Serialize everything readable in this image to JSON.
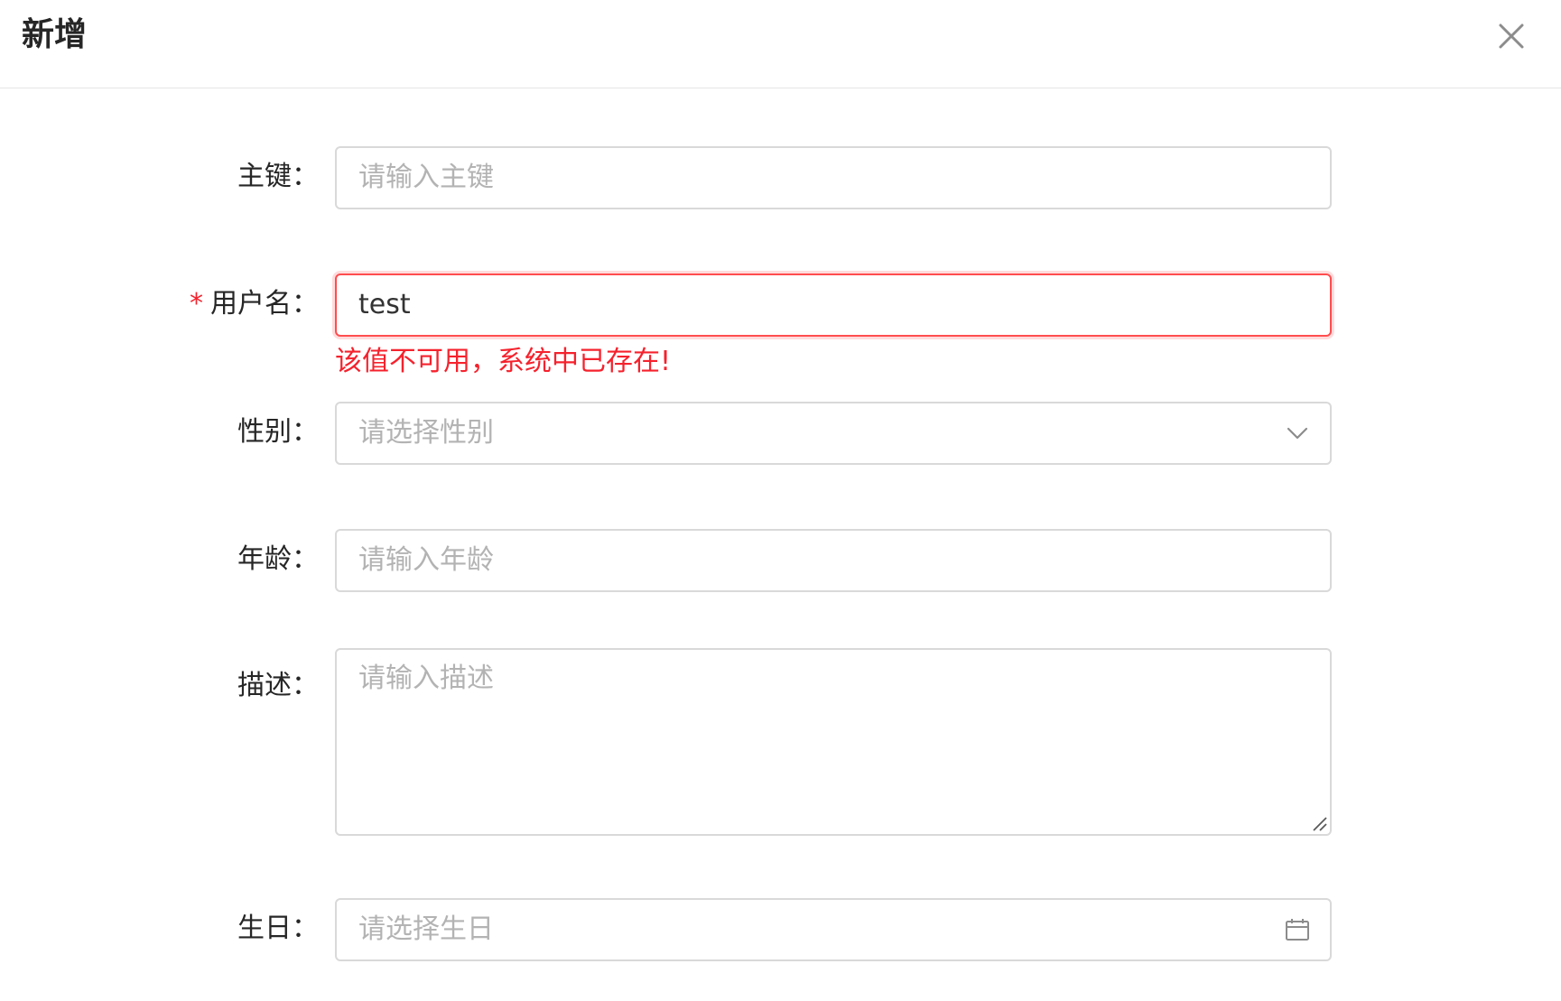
{
  "modal": {
    "title": "新增"
  },
  "form": {
    "id": {
      "label": "主键：",
      "placeholder": "请输入主键",
      "value": ""
    },
    "username": {
      "required_mark": "*",
      "label": "用户名：",
      "value": "test",
      "error": "该值不可用，系统中已存在!"
    },
    "gender": {
      "label": "性别：",
      "placeholder": "请选择性别",
      "icon": "chevron-down-icon"
    },
    "age": {
      "label": "年龄：",
      "placeholder": "请输入年龄",
      "value": ""
    },
    "description": {
      "label": "描述：",
      "placeholder": "请输入描述",
      "value": ""
    },
    "birthday": {
      "label": "生日：",
      "placeholder": "请选择生日",
      "icon": "calendar-icon"
    }
  },
  "colors": {
    "error": "#f5222d",
    "border": "#d9d9d9",
    "placeholder": "#b3b3b3"
  }
}
